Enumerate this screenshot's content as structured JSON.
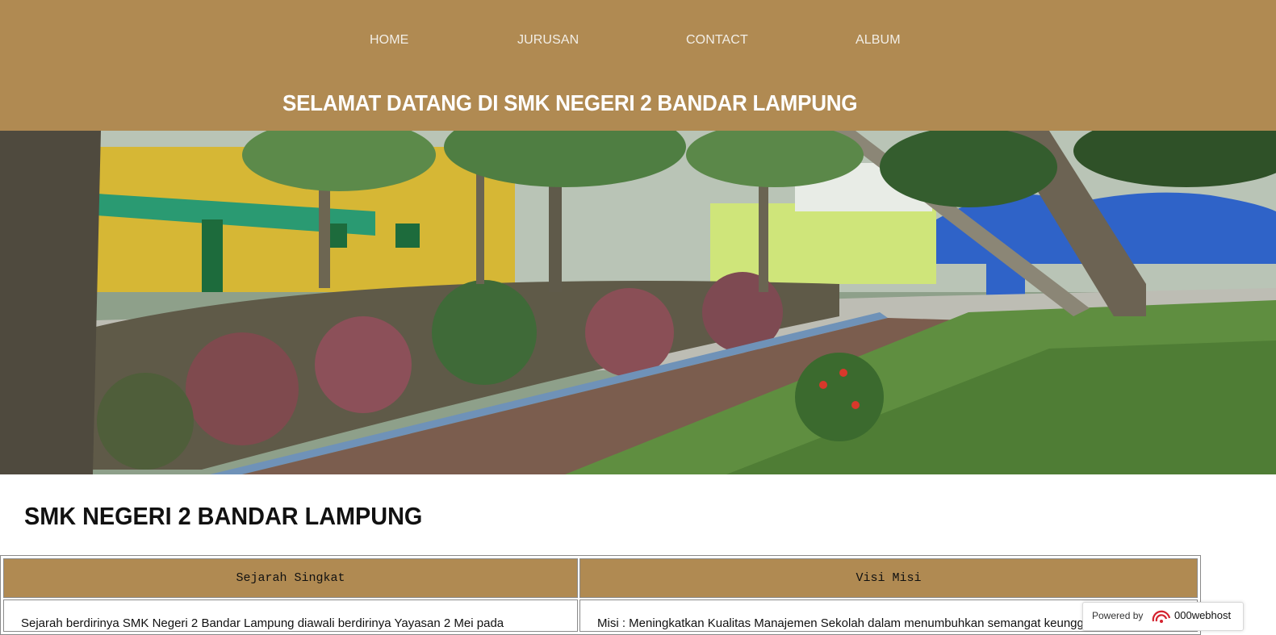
{
  "nav": {
    "items": [
      {
        "label": "HOME"
      },
      {
        "label": "JURUSAN"
      },
      {
        "label": "CONTACT"
      },
      {
        "label": "ALBUM"
      }
    ]
  },
  "header": {
    "welcome": "SELAMAT DATANG DI SMK NEGERI 2 BANDAR LAMPUNG"
  },
  "hero": {
    "description": "Photo of the school courtyard with trees, garden beds and buildings"
  },
  "main": {
    "title": "SMK NEGERI 2 BANDAR LAMPUNG",
    "columns": [
      {
        "heading": "Sejarah Singkat",
        "text": "Sejarah berdirinya SMK Negeri 2 Bandar Lampung diawali berdirinya Yayasan 2 Mei pada"
      },
      {
        "heading": "Visi Misi",
        "text": "Misi : Meningkatkan Kualitas Manajemen Sekolah dalam menumbuhkan semangat keunggulan"
      }
    ]
  },
  "badge": {
    "powered_by": "Powered by",
    "brand": "000webhost"
  },
  "colors": {
    "header_bg": "#b08a52",
    "nav_text": "#f2eee6",
    "table_header_bg": "#b08a52"
  }
}
